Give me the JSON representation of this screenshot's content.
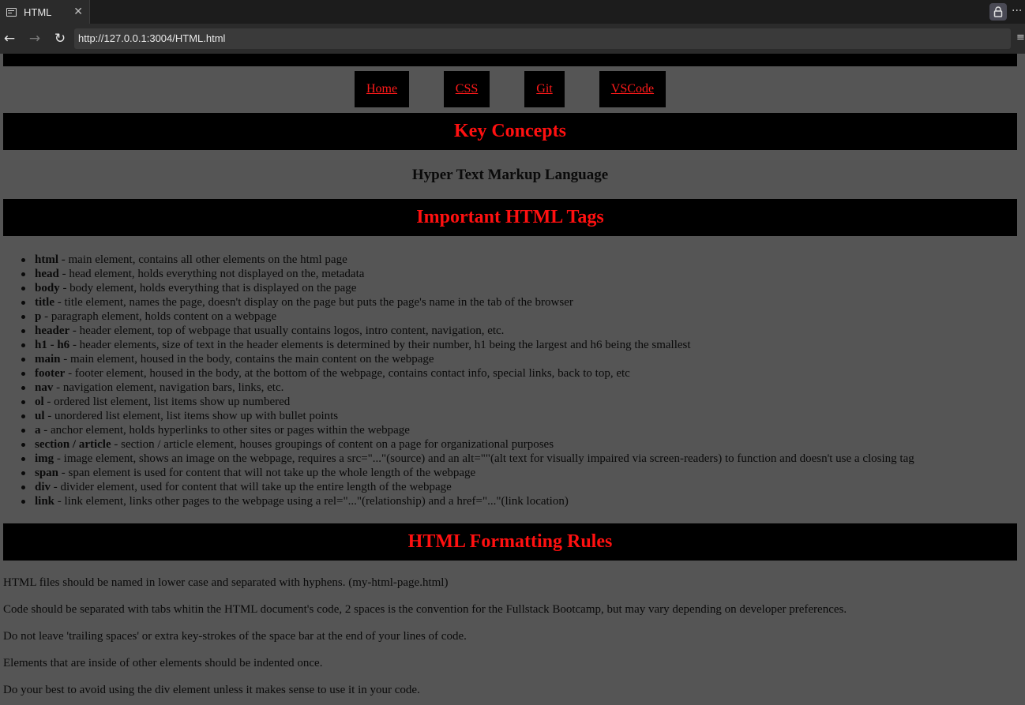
{
  "browser": {
    "tab_title": "HTML",
    "tab_close": "✕",
    "url": "http://127.0.0.1:3004/HTML.html",
    "more_label": "···",
    "side_menu": "≡"
  },
  "nav": {
    "items": [
      "Home",
      "CSS",
      "Git",
      "VSCode"
    ]
  },
  "sections": {
    "key_concepts": "Key Concepts",
    "subtitle": "Hyper Text Markup Language",
    "important_tags": "Important HTML Tags",
    "formatting_rules": "HTML Formatting Rules"
  },
  "tags": [
    {
      "tag": "html",
      "desc": " - main element, contains all other elements on the html page"
    },
    {
      "tag": "head",
      "desc": " - head element, holds everything not displayed on the, metadata"
    },
    {
      "tag": "body",
      "desc": " - body element, holds everything that is displayed on the page"
    },
    {
      "tag": "title",
      "desc": " - title element, names the page, doesn't display on the page but puts the page's name in the tab of the browser"
    },
    {
      "tag": "p",
      "desc": " - paragraph element, holds content on a webpage"
    },
    {
      "tag": "header",
      "desc": " - header element, top of webpage that usually contains logos, intro content, navigation, etc."
    },
    {
      "tag": "h1 - h6",
      "desc": " - header elements, size of text in the header elements is determined by their number, h1 being the largest and h6 being the smallest"
    },
    {
      "tag": "main",
      "desc": " - main element, housed in the body, contains the main content on the webpage"
    },
    {
      "tag": "footer",
      "desc": " - footer element, housed in the body, at the bottom of the webpage, contains contact info, special links, back to top, etc"
    },
    {
      "tag": "nav",
      "desc": " - navigation element, navigation bars, links, etc."
    },
    {
      "tag": "ol",
      "desc": " - ordered list element, list items show up numbered"
    },
    {
      "tag": "ul",
      "desc": " - unordered list element, list items show up with bullet points"
    },
    {
      "tag": "a",
      "desc": " - anchor element, holds hyperlinks to other sites or pages within the webpage"
    },
    {
      "tag": "section / article",
      "desc": " - section / article element, houses groupings of content on a page for organizational purposes"
    },
    {
      "tag": "img",
      "desc": " - image element, shows an image on the webpage, requires a src=\"...\"(source) and an alt=\"\"(alt text for visually impaired via screen-readers) to function and doesn't use a closing tag"
    },
    {
      "tag": "span",
      "desc": " - span element is used for content that will not take up the whole length of the webpage"
    },
    {
      "tag": "div",
      "desc": " - divider element, used for content that will take up the entire length of the webpage"
    },
    {
      "tag": "link",
      "desc": " - link element, links other pages to the webpage using a rel=\"...\"(relationship) and a href=\"...\"(link location)"
    }
  ],
  "rules": [
    "HTML files should be named in lower case and separated with hyphens. (my-html-page.html)",
    "Code should be separated with tabs whitin the HTML document's code, 2 spaces is the convention for the Fullstack Bootcamp, but may vary depending on developer preferences.",
    "Do not leave 'trailing spaces' or extra key-strokes of the space bar at the end of your lines of code.",
    "Elements that are inside of other elements should be indented once.",
    "Do your best to avoid using the div element unless it makes sense to use it in your code."
  ]
}
